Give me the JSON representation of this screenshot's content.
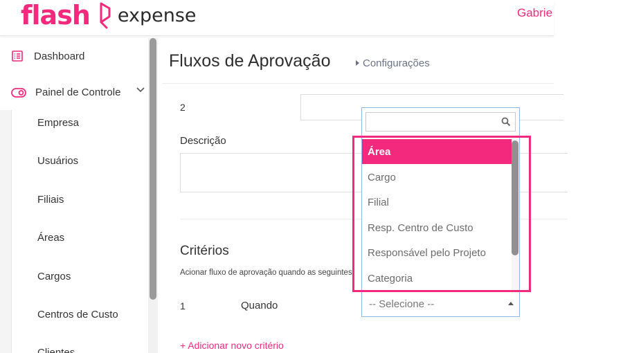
{
  "brand": {
    "name_primary": "flash",
    "name_secondary": "expense"
  },
  "header": {
    "user_name": "Gabrie"
  },
  "sidebar": {
    "dashboard_label": "Dashboard",
    "painel_label": "Painel de Controle",
    "sub_items": [
      "Empresa",
      "Usuários",
      "Filiais",
      "Áreas",
      "Cargos",
      "Centros de Custo",
      "Clientes"
    ]
  },
  "page": {
    "title": "Fluxos de Aprovação",
    "breadcrumb": "Configurações",
    "step_number": "2",
    "description_label": "Descrição",
    "criteria_title": "Critérios",
    "criteria_description": "Acionar fluxo de aprovação quando as seguintes",
    "criterion_number": "1",
    "criterion_when": "Quando",
    "add_criterion": "+ Adicionar novo critério"
  },
  "dropdown": {
    "search_value": "",
    "options": [
      "Área",
      "Cargo",
      "Filial",
      "Resp. Centro de Custo",
      "Responsável pelo Projeto",
      "Categoria"
    ],
    "selected_index": 0,
    "placeholder": "-- Selecione --"
  },
  "colors": {
    "accent": "#f2297d",
    "focus_border": "#8fb8e6"
  }
}
